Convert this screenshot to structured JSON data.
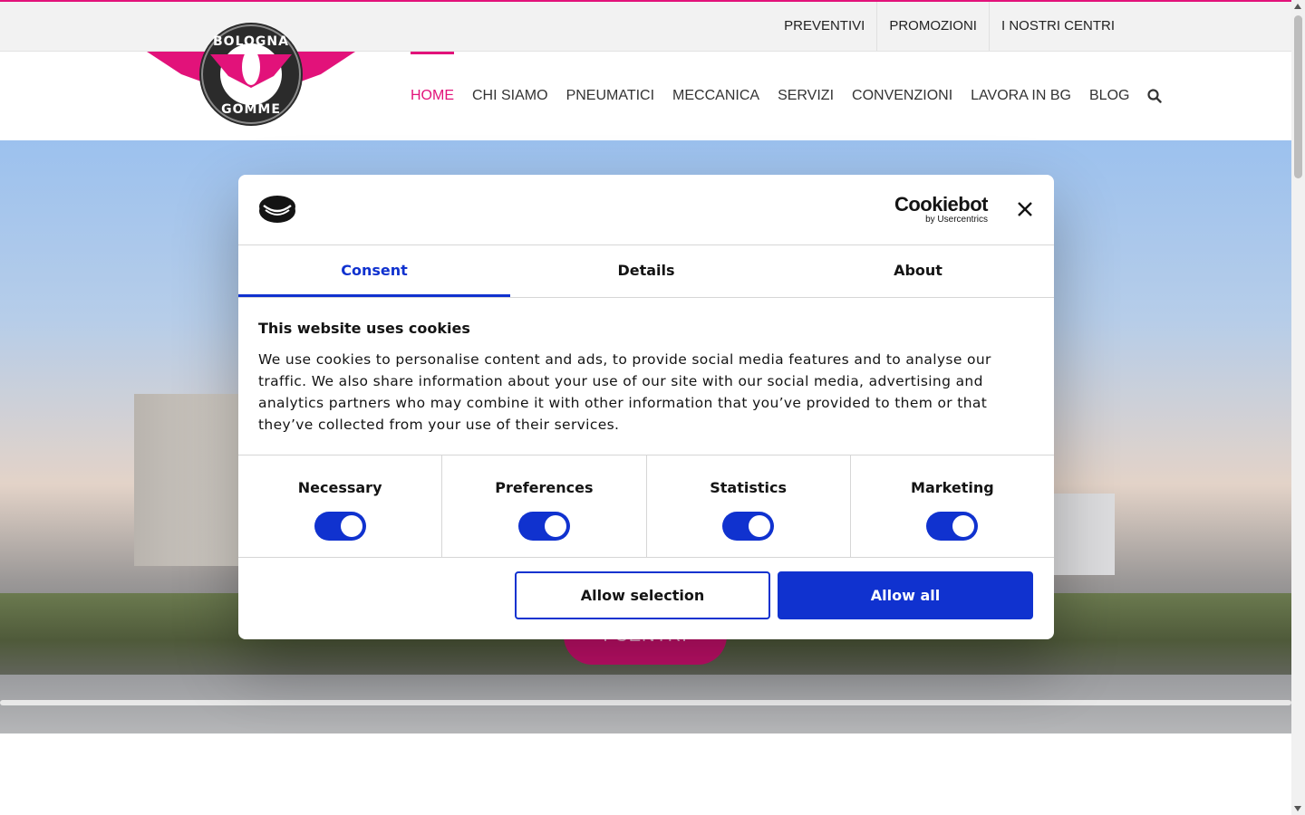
{
  "topbar": {
    "links": [
      "PREVENTIVI",
      "PROMOZIONI",
      "I NOSTRI CENTRI"
    ]
  },
  "logo": {
    "top_text": "BOLOGNA",
    "bottom_text": "GOMME"
  },
  "nav": {
    "items": [
      "HOME",
      "CHI SIAMO",
      "PNEUMATICI",
      "MECCANICA",
      "SERVIZI",
      "CONVENZIONI",
      "LAVORA IN BG",
      "BLOG"
    ],
    "active": "HOME"
  },
  "hero": {
    "cta_label": "I CENTRI"
  },
  "cookie_dialog": {
    "brand": "Cookiebot",
    "brand_sub": "by Usercentrics",
    "tabs": [
      "Consent",
      "Details",
      "About"
    ],
    "active_tab": "Consent",
    "heading": "This website uses cookies",
    "body": "We use cookies to personalise content and ads, to provide social media features and to analyse our traffic. We also share information about your use of our site with our social media, advertising and analytics partners who may combine it with other information that you’ve provided to them or that they’ve collected from your use of their services.",
    "categories": [
      {
        "label": "Necessary",
        "enabled": true
      },
      {
        "label": "Preferences",
        "enabled": true
      },
      {
        "label": "Statistics",
        "enabled": true
      },
      {
        "label": "Marketing",
        "enabled": true
      }
    ],
    "allow_selection_label": "Allow selection",
    "allow_all_label": "Allow all"
  },
  "colors": {
    "brand_pink": "#e2127a",
    "cookiebot_blue": "#1032cf"
  }
}
